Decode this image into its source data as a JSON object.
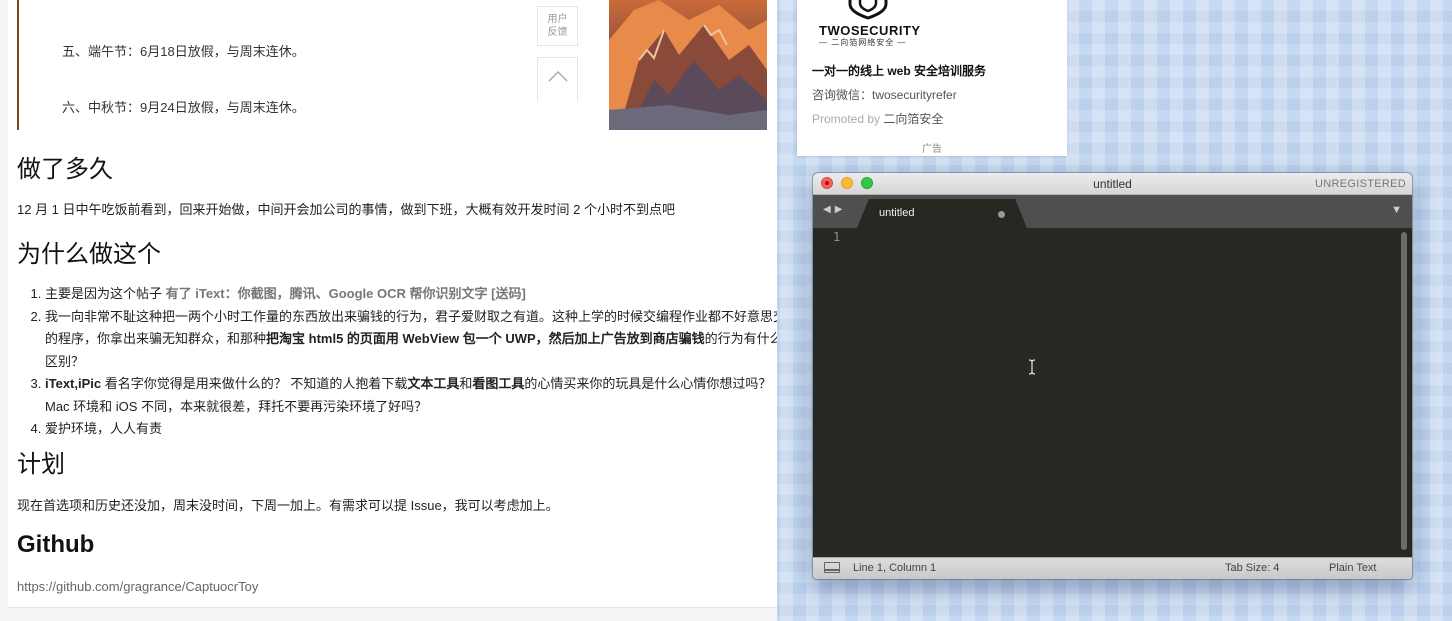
{
  "article": {
    "holiday_5": "五、端午节：6月18日放假，与周末连休。",
    "holiday_6": "六、中秋节：9月24日放假，与周末连休。",
    "feedback_button": "用户\n反馈",
    "sections": {
      "how_long": {
        "heading": "做了多久",
        "text": "12 月 1 日中午吃饭前看到，回来开始做，中间开会加公司的事情，做到下班，大概有效开发时间 2 个小时不到点吧"
      },
      "why": {
        "heading": "为什么做这个",
        "items": [
          {
            "text_before": "主要是因为这个帖子 ",
            "link": "有了 iText：你截图，腾讯、Google OCR 帮你识别文字 [送码]"
          },
          {
            "text_before": "我一向非常不耻这种把一两个小时工作量的东西放出来骗钱的行为，君子爱财取之有道。这种上学的时候交编程作业都不好意思交的程序，你拿出来骗无知群众，和那种",
            "bold": "把淘宝 html5 的页面用 WebView 包一个 UWP，然后加上广告放到商店骗钱",
            "text_after": "的行为有什么区别？"
          },
          {
            "bold_1": "iText,iPic",
            "text_1": " 看名字你觉得是用来做什么的？ 不知道的人抱着下载",
            "bold_2": "文本工具",
            "text_2": "和",
            "bold_3": "看图工具",
            "text_3": "的心情买来你的玩具是什么心情你想过吗？ Mac 环境和 iOS 不同，本来就很差，拜托不要再污染环境了好吗？"
          },
          {
            "text": "爱护环境，人人有责"
          }
        ]
      },
      "plan": {
        "heading": "计划",
        "text": "现在首选项和历史还没加，周末没时间，下周一加上。有需求可以提 Issue，我可以考虑加上。"
      },
      "github": {
        "heading": "Github",
        "link": "https://github.com/gragrance/CaptuocrToy"
      }
    }
  },
  "ad": {
    "brand": "TWOSECURITY",
    "brand_sub": "二向箔网络安全",
    "headline": "一对一的线上 web 安全培训服务",
    "wechat": "咨询微信：twosecurityrefer",
    "promoted_prefix": "Promoted by ",
    "promoted_by": "二向箔安全",
    "label": "广告"
  },
  "editor": {
    "window_title": "untitled",
    "registration": "UNREGISTERED",
    "tab_label": "untitled",
    "line_number": "1",
    "status": {
      "position": "Line 1, Column 1",
      "tab_size": "Tab Size: 4",
      "syntax": "Plain Text"
    }
  }
}
